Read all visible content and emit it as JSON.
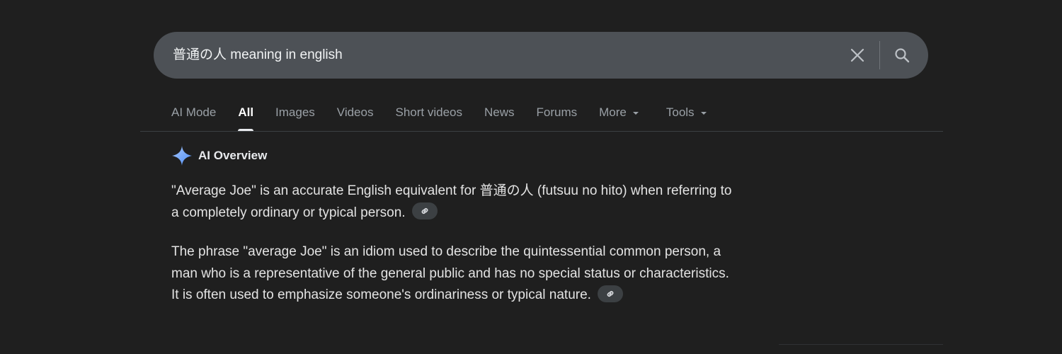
{
  "search": {
    "query": "普通の人 meaning in english"
  },
  "tabs": [
    {
      "label": "AI Mode"
    },
    {
      "label": "All"
    },
    {
      "label": "Images"
    },
    {
      "label": "Videos"
    },
    {
      "label": "Short videos"
    },
    {
      "label": "News"
    },
    {
      "label": "Forums"
    },
    {
      "label": "More"
    },
    {
      "label": "Tools"
    }
  ],
  "active_tab": "All",
  "ai_overview": {
    "title": "AI Overview",
    "paragraphs": [
      "\"Average Joe\" is an accurate English equivalent for 普通の人 (futsuu no hito) when referring to a completely ordinary or typical person.",
      "The phrase \"average Joe\" is an idiom used to describe the quintessential common person, a man who is a representative of the general public and has no special status or characteristics. It is often used to emphasize someone's ordinariness or typical nature."
    ]
  },
  "icons": {
    "clear": "close-icon",
    "search": "search-icon",
    "ai": "sparkle-icon",
    "source": "link-icon",
    "dropdown": "chevron-down-icon"
  },
  "colors": {
    "background": "#1f1f1f",
    "search_bar": "#4d5156",
    "text": "#e3e3e3",
    "muted": "#9aa0a6",
    "sparkle_blue": "#4c8df6",
    "sparkle_light": "#a8c7fa"
  }
}
